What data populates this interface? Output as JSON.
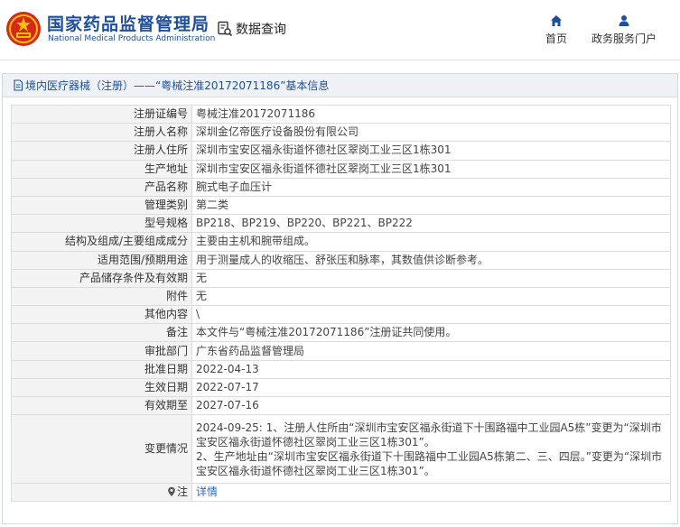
{
  "header": {
    "title_cn": "国家药品监督管理局",
    "title_en": "National Medical Products Administration",
    "search_label": "数据查询",
    "nav": [
      {
        "label": "首页",
        "icon": "home-icon"
      },
      {
        "label": "政务服务门户",
        "icon": "user-icon"
      }
    ]
  },
  "panel": {
    "title": "境内医疗器械（注册）——“粤械注准20172071186”基本信息"
  },
  "fields": [
    {
      "label": "注册证编号",
      "value": "粤械注准20172071186"
    },
    {
      "label": "注册人名称",
      "value": "深圳金亿帝医疗设备股份有限公司"
    },
    {
      "label": "注册人住所",
      "value": "深圳市宝安区福永街道怀德社区翠岗工业三区1栋301"
    },
    {
      "label": "生产地址",
      "value": "深圳市宝安区福永街道怀德社区翠岗工业三区1栋301"
    },
    {
      "label": "产品名称",
      "value": "腕式电子血压计"
    },
    {
      "label": "管理类别",
      "value": "第二类"
    },
    {
      "label": "型号规格",
      "value": "BP218、BP219、BP220、BP221、BP222"
    },
    {
      "label": "结构及组成/主要组成成分",
      "value": "主要由主机和腕带组成。"
    },
    {
      "label": "适用范围/预期用途",
      "value": "用于测量成人的收缩压、舒张压和脉率，其数值供诊断参考。"
    },
    {
      "label": "产品储存条件及有效期",
      "value": "无"
    },
    {
      "label": "附件",
      "value": "无"
    },
    {
      "label": "其他内容",
      "value": "\\"
    },
    {
      "label": "备注",
      "value": "本文件与“粤械注准20172071186”注册证共同使用。"
    },
    {
      "label": "审批部门",
      "value": "广东省药品监督管理局"
    },
    {
      "label": "批准日期",
      "value": "2022-04-13"
    },
    {
      "label": "生效日期",
      "value": "2022-07-17"
    },
    {
      "label": "有效期至",
      "value": "2027-07-16"
    }
  ],
  "changes": {
    "label": "变更情况",
    "line1": "2024-09-25: 1、注册人住所由“深圳市宝安区福永街道下十围路福中工业园A5栋”变更为“深圳市宝安区福永街道怀德社区翠岗工业三区1栋301”。",
    "line2": "2、生产地址由“深圳市宝安区福永街道下十围路福中工业园A5栋第二、三、四层。”变更为“深圳市宝安区福永街道怀德社区翠岗工业三区1栋301”。"
  },
  "note": {
    "label": "注",
    "link": "详情"
  },
  "colors": {
    "brand_blue": "#1e4f9c",
    "emblem_red": "#d9261c",
    "emblem_gold": "#f2c200",
    "link": "#2a6bc4"
  }
}
